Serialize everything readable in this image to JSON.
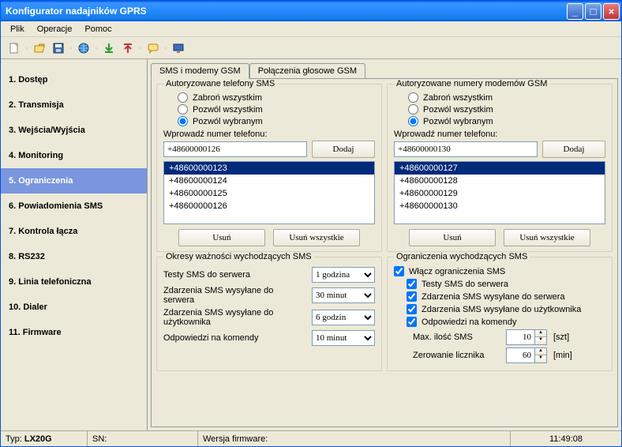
{
  "window": {
    "title": "Konfigurator nadajników GPRS"
  },
  "menu": {
    "file": "Plik",
    "ops": "Operacje",
    "help": "Pomoc"
  },
  "sidebar": {
    "items": [
      "1. Dostęp",
      "2. Transmisja",
      "3. Wejścia/Wyjścia",
      "4. Monitoring",
      "5. Ograniczenia",
      "6. Powiadomienia SMS",
      "7. Kontrola łącza",
      "8. RS232",
      "9. Linia telefoniczna",
      "10. Dialer",
      "11. Firmware"
    ],
    "active_index": 4
  },
  "tabs": {
    "items": [
      "SMS i modemy GSM",
      "Połączenia głosowe GSM"
    ],
    "active_index": 0
  },
  "sms_phones": {
    "title": "Autoryzowane telefony SMS",
    "radio_deny": "Zabroń wszystkim",
    "radio_allow_all": "Pozwól wszystkim",
    "radio_allow_sel": "Pozwól wybranym",
    "radio_selected": 2,
    "enter_label": "Wprowadź numer telefonu:",
    "input_value": "+48600000126",
    "add_btn": "Dodaj",
    "list": [
      "+48600000123",
      "+48600000124",
      "+48600000125",
      "+48600000126"
    ],
    "selected_index": 0,
    "del_btn": "Usuń",
    "del_all_btn": "Usuń wszystkie"
  },
  "modem_numbers": {
    "title": "Autoryzowane numery modemów GSM",
    "radio_deny": "Zabroń wszystkim",
    "radio_allow_all": "Pozwól wszystkim",
    "radio_allow_sel": "Pozwól wybranym",
    "radio_selected": 2,
    "enter_label": "Wprowadź numer telefonu:",
    "input_value": "+48600000130",
    "add_btn": "Dodaj",
    "list": [
      "+48600000127",
      "+48600000128",
      "+48600000129",
      "+48600000130"
    ],
    "selected_index": 0,
    "del_btn": "Usuń",
    "del_all_btn": "Usuń wszystkie"
  },
  "validity": {
    "title": "Okresy ważności wychodzących SMS",
    "rows": [
      {
        "label": "Testy SMS do serwera",
        "value": "1 godzina"
      },
      {
        "label": "Zdarzenia SMS wysyłane do serwera",
        "value": "30 minut"
      },
      {
        "label": "Zdarzenia SMS wysyłane do użytkownika",
        "value": "6 godzin"
      },
      {
        "label": "Odpowiedzi na komendy",
        "value": "10 minut"
      }
    ]
  },
  "limits": {
    "title": "Ograniczenia wychodzących SMS",
    "enable": "Włącz ograniczenia SMS",
    "cb_tests": "Testy SMS do serwera",
    "cb_events_srv": "Zdarzenia SMS wysyłane do serwera",
    "cb_events_usr": "Zdarzenia SMS wysyłane do użytkownika",
    "cb_replies": "Odpowiedzi na komendy",
    "max_label": "Max. ilość SMS",
    "max_value": "10",
    "max_unit": "[szt]",
    "reset_label": "Zerowanie licznika",
    "reset_value": "60",
    "reset_unit": "[min]"
  },
  "status": {
    "type_label": "Typ:",
    "type_value": "LX20G",
    "sn_label": "SN:",
    "fw_label": "Wersja firmware:",
    "time": "11:49:08"
  }
}
